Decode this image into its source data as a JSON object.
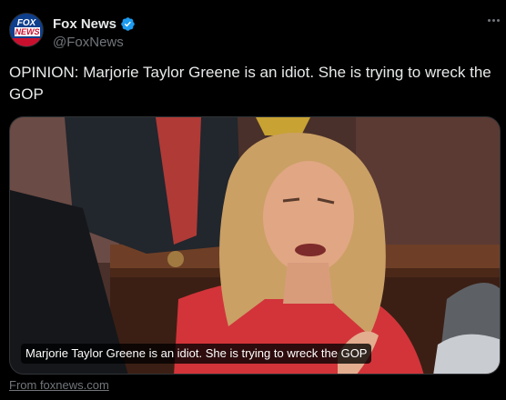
{
  "account": {
    "display_name": "Fox News",
    "handle": "@FoxNews",
    "verified": true,
    "avatar_logo_top": "FOX",
    "avatar_logo_mid": "NEWS"
  },
  "tweet": {
    "text": "OPINION: Marjorie Taylor Greene is an idiot. She is trying to wreck the GOP"
  },
  "link_card": {
    "caption": "Marjorie Taylor Greene is an idiot. She is trying to wreck the GOP",
    "source": "From foxnews.com"
  },
  "icons": {
    "verified": "verified-badge-icon",
    "more": "more-options-icon"
  },
  "colors": {
    "background": "#000000",
    "primary_text": "#e7e9ea",
    "secondary_text": "#71767b",
    "verified_blue": "#1d9bf0",
    "border": "#2f3336"
  }
}
